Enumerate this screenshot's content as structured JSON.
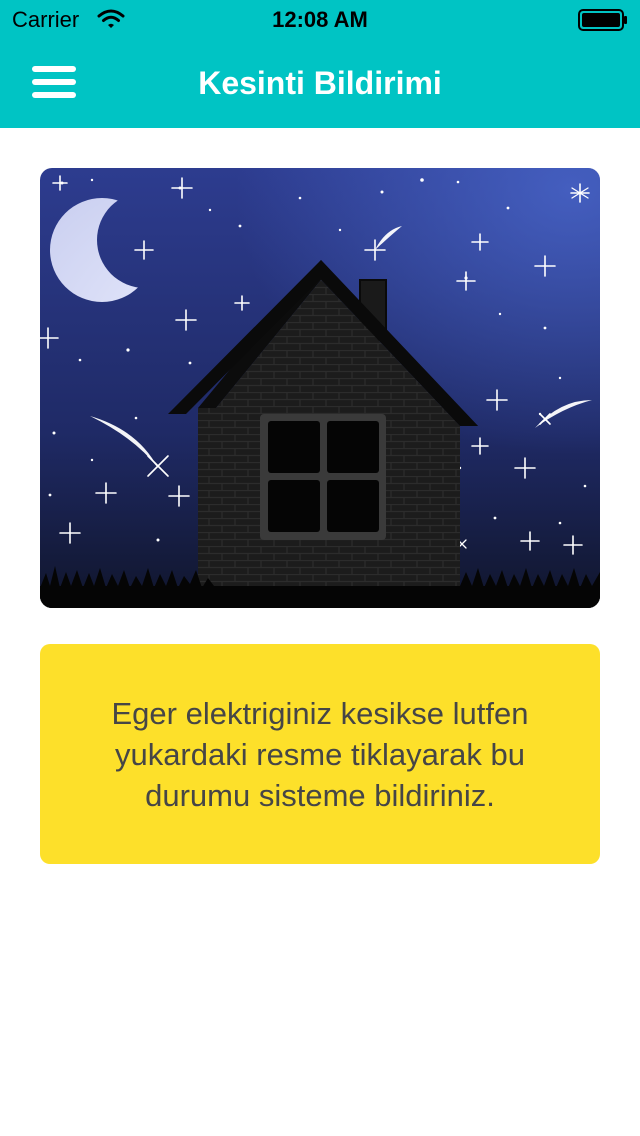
{
  "status_bar": {
    "carrier": "Carrier",
    "time": "12:08 AM",
    "wifi_icon": "wifi-icon",
    "battery_icon": "battery-icon"
  },
  "nav": {
    "menu_icon": "hamburger-menu-icon",
    "title": "Kesinti Bildirimi"
  },
  "illustration": {
    "description_icon": "night-house-icon"
  },
  "info": {
    "lines": [
      "Eger elektriginiz kesikse lutfen",
      "yukardaki resme tiklayarak bu",
      "durumu sisteme bildiriniz."
    ]
  },
  "colors": {
    "header": "#00c4c4",
    "info_box": "#fde02a",
    "info_text": "#464646",
    "sky_top": "#2e3f94",
    "sky_bottom": "#12172e"
  }
}
